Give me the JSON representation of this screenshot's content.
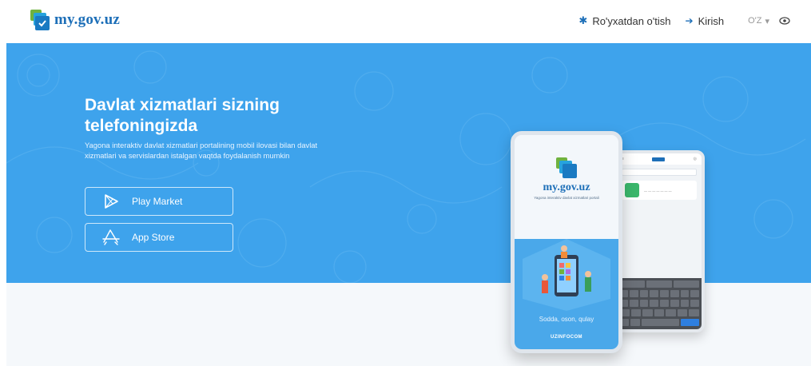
{
  "header": {
    "logo_text": "my.gov.uz",
    "nav": {
      "register": "Ro'yxatdan o'tish",
      "login": "Kirish",
      "language": "O'Z"
    },
    "icons": {
      "register": "gear-icon",
      "login": "sign-in-icon",
      "language": "chevron-down-icon",
      "accessibility": "eye-icon"
    }
  },
  "hero": {
    "title": "Davlat xizmatlari sizning telefoningizda",
    "subtitle": "Yagona interaktiv davlat xizmatlari portalining mobil ilovasi bilan davlat xizmatlari va servislardan istalgan vaqtda foydalanish mumkin",
    "buttons": {
      "play_market": "Play Market",
      "app_store": "App Store"
    },
    "background_color": "#3ea3ec"
  },
  "phone": {
    "brand": "my.gov.uz",
    "tagline": "Yagona interaktiv davlat xizmatlari portali",
    "slogan": "Sodda, oson, qulay",
    "footer_brand": "UZINFOCOM"
  },
  "colors": {
    "brand_blue": "#1d6fb8",
    "brand_green": "#6fb23f",
    "hero_blue": "#3ea3ec"
  }
}
